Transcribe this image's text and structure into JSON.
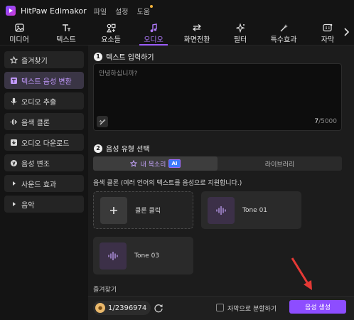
{
  "app": {
    "title": "HitPaw Edimakor"
  },
  "menu": [
    "파일",
    "설정",
    "도움"
  ],
  "toolbar": {
    "tabs": [
      {
        "label": "미디어",
        "icon": "media-image-icon"
      },
      {
        "label": "텍스트",
        "icon": "text-icon"
      },
      {
        "label": "요소들",
        "icon": "elements-icon"
      },
      {
        "label": "오디오",
        "icon": "music-note-icon",
        "active": true
      },
      {
        "label": "화면전환",
        "icon": "transition-arrows-icon"
      },
      {
        "label": "필터",
        "icon": "sparkle-filter-icon"
      },
      {
        "label": "특수효과",
        "icon": "magic-wand-icon"
      },
      {
        "label": "자막",
        "icon": "subtitle-ai-icon"
      }
    ]
  },
  "sidebar": {
    "items": [
      {
        "label": "즐겨찾기",
        "icon": "star-icon"
      },
      {
        "label": "텍스트 음성 변환",
        "icon": "text-to-speech-icon",
        "active": true
      },
      {
        "label": "오디오 추출",
        "icon": "microphone-icon"
      },
      {
        "label": "음색 클론",
        "icon": "waveform-icon"
      },
      {
        "label": "오디오 다운로드",
        "icon": "download-icon"
      },
      {
        "label": "음성 변조",
        "icon": "voice-changer-icon"
      },
      {
        "label": "사운드 효과",
        "icon": "caret-right-icon"
      },
      {
        "label": "음악",
        "icon": "caret-right-icon"
      }
    ]
  },
  "main": {
    "section1": {
      "number": "1",
      "title": "텍스트 입력하기"
    },
    "text_input": {
      "placeholder": "안녕하십니까?",
      "count": "7",
      "max": "/5000"
    },
    "section2": {
      "number": "2",
      "title": "음성 유형 선택"
    },
    "voice_tabs": {
      "my_voice": "내 목소리",
      "ai_badge": "AI",
      "library": "라이브러리"
    },
    "clone_desc": "음색 클론 (여러 언어의 텍스트를 음성으로 지원합니다.)",
    "cards": {
      "clone_click": "클론 클릭",
      "tone01": "Tone 01",
      "tone03": "Tone 03"
    },
    "favorites_label": "즐겨찾기"
  },
  "bottom": {
    "credits": "1/2396974",
    "split_label": "자막으로 분할하기",
    "generate_label": "음성 생성"
  },
  "colors": {
    "accent": "#8d4dff",
    "active_text": "#c39aff",
    "background": "#141414",
    "panel": "#1c1c1c"
  }
}
